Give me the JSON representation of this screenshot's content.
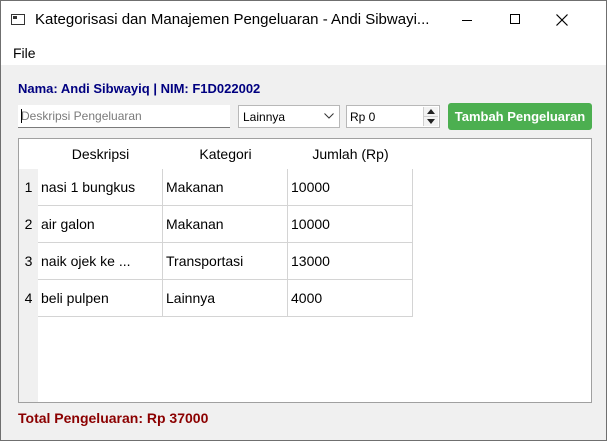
{
  "window": {
    "title": "Kategorisasi dan Manajemen Pengeluaran - Andi Sibwayi..."
  },
  "menu": {
    "file_label": "File"
  },
  "user_info": "Nama: Andi Sibwayiq | NIM: F1D022002",
  "form": {
    "description_placeholder": "Deskripsi Pengeluaran",
    "description_value": "",
    "category_selected": "Lainnya",
    "amount_value": "Rp 0",
    "add_button_label": "Tambah Pengeluaran"
  },
  "table": {
    "headers": [
      "Deskripsi",
      "Kategori",
      "Jumlah (Rp)"
    ],
    "rows": [
      {
        "num": "1",
        "deskripsi": "nasi 1 bungkus",
        "kategori": "Makanan",
        "jumlah": "10000"
      },
      {
        "num": "2",
        "deskripsi": "air galon",
        "kategori": "Makanan",
        "jumlah": "10000"
      },
      {
        "num": "3",
        "deskripsi": "naik ojek ke ...",
        "kategori": "Transportasi",
        "jumlah": "13000"
      },
      {
        "num": "4",
        "deskripsi": "beli pulpen",
        "kategori": "Lainnya",
        "jumlah": "4000"
      }
    ]
  },
  "total_label": "Total Pengeluaran: Rp 37000",
  "colors": {
    "accent_button": "#4caf50",
    "user_info_text": "#000080",
    "total_text": "#8b0000"
  }
}
